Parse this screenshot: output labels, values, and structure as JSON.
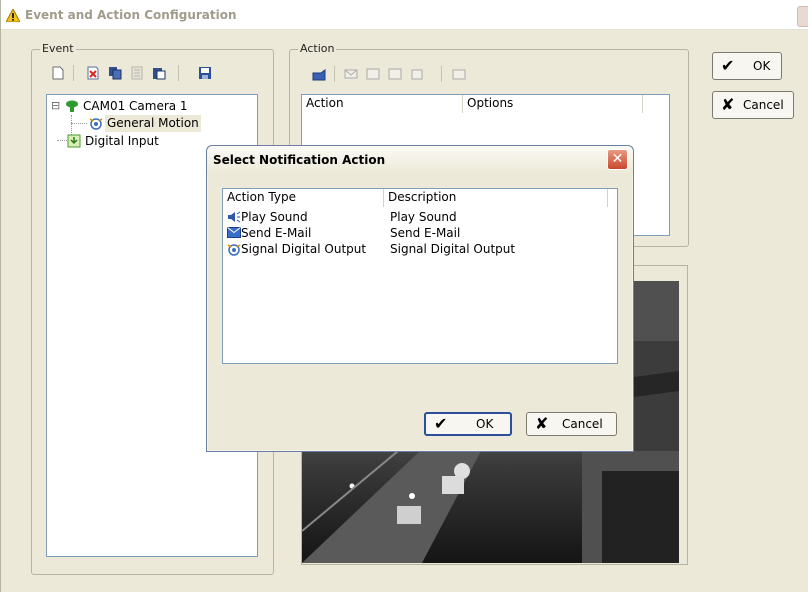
{
  "window": {
    "title": "Event and Action Configuration",
    "accent_color": "#316ac5",
    "close_icon": "close-icon"
  },
  "event_panel": {
    "label": "Event",
    "toolbar_icons": [
      "new-icon",
      "delete-icon",
      "copy-icon",
      "disabled-icon",
      "paste-icon",
      "save-icon"
    ],
    "tree": [
      {
        "label": "CAM01 Camera 1",
        "icon": "camera-icon",
        "expander": "⊟"
      },
      {
        "label": "General Motion",
        "icon": "motion-icon"
      },
      {
        "label": "Digital Input",
        "icon": "digital-input-icon"
      }
    ]
  },
  "action_panel": {
    "label": "Action",
    "toolbar_icons": [
      "add-action-icon",
      "email-icon",
      "disabled-icon",
      "disabled-icon",
      "disabled-icon",
      "disabled-icon"
    ],
    "columns": [
      "Action",
      "Options"
    ]
  },
  "main_buttons": {
    "ok": "OK",
    "cancel": "Cancel"
  },
  "dialog": {
    "title": "Select Notification Action",
    "columns": [
      "Action Type",
      "Description"
    ],
    "rows": [
      {
        "type": "Play Sound",
        "description": "Play Sound",
        "icon": "speaker-icon"
      },
      {
        "type": "Send E-Mail",
        "description": "Send E-Mail",
        "icon": "envelope-icon"
      },
      {
        "type": "Signal Digital Output",
        "description": "Signal Digital Output",
        "icon": "digital-output-icon"
      }
    ],
    "ok": "OK",
    "cancel": "Cancel"
  }
}
